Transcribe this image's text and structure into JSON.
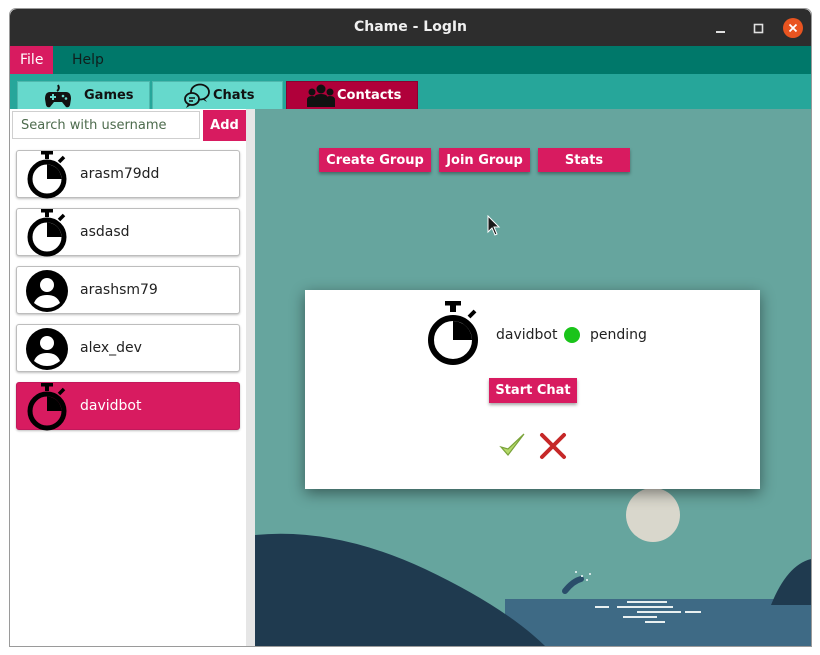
{
  "window": {
    "title": "Chame - LogIn"
  },
  "menu": {
    "file": "File",
    "help": "Help"
  },
  "tabs": [
    {
      "label": "Games",
      "icon": "gamepad-icon"
    },
    {
      "label": "Chats",
      "icon": "chat-bubbles-icon"
    },
    {
      "label": "Contacts",
      "icon": "people-icon"
    }
  ],
  "sidebar": {
    "search_placeholder": "Search with username",
    "add_label": "Add",
    "contacts": [
      {
        "name": "arasm79dd",
        "icon": "stopwatch-icon"
      },
      {
        "name": "asdasd",
        "icon": "stopwatch-icon"
      },
      {
        "name": "arashsm79",
        "icon": "person-icon"
      },
      {
        "name": "alex_dev",
        "icon": "person-icon"
      },
      {
        "name": "davidbot",
        "icon": "stopwatch-icon",
        "selected": true
      }
    ]
  },
  "main": {
    "buttons": {
      "create_group": "Create Group",
      "join_group": "Join Group",
      "stats": "Stats"
    },
    "dialog": {
      "name": "davidbot",
      "status": "pending",
      "status_color": "#1ac41a",
      "start_chat": "Start Chat"
    }
  },
  "colors": {
    "accent": "#d81b60",
    "menubar": "#00786a",
    "tabbar": "#26a69a",
    "background": "#66a59e"
  }
}
